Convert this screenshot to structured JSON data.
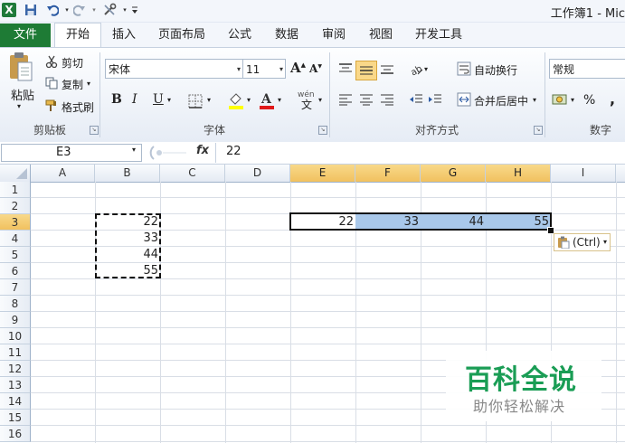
{
  "window": {
    "title": "工作簿1 - Mic",
    "app_logo": "X"
  },
  "quick_access": {
    "icons": [
      "save-icon",
      "undo-icon",
      "redo-icon",
      "tools-icon",
      "customize-icon"
    ]
  },
  "tabs": [
    {
      "label": "文件"
    },
    {
      "label": "开始"
    },
    {
      "label": "插入"
    },
    {
      "label": "页面布局"
    },
    {
      "label": "公式"
    },
    {
      "label": "数据"
    },
    {
      "label": "审阅"
    },
    {
      "label": "视图"
    },
    {
      "label": "开发工具"
    }
  ],
  "clipboard": {
    "paste": "粘贴",
    "cut": "剪切",
    "copy": "复制",
    "format_painter": "格式刷",
    "group": "剪贴板"
  },
  "font": {
    "name": "宋体",
    "size": "11",
    "grow": "A",
    "shrink": "A",
    "bold": "B",
    "italic": "I",
    "underline": "U",
    "group": "字体",
    "phonetic": "wén"
  },
  "alignment": {
    "wrap": "自动换行",
    "merge": "合并后居中",
    "group": "对齐方式"
  },
  "number": {
    "format": "常规",
    "percent": "%",
    "comma": ",",
    "group": "数字"
  },
  "formula_bar": {
    "name_box": "E3",
    "fx": "fx",
    "value": "22"
  },
  "columns": [
    "A",
    "B",
    "C",
    "D",
    "E",
    "F",
    "G",
    "H",
    "I"
  ],
  "rows": [
    "1",
    "2",
    "3",
    "4",
    "5",
    "6",
    "7",
    "8",
    "9",
    "10",
    "11",
    "12",
    "13",
    "14",
    "15",
    "16"
  ],
  "cells": {
    "B3": "22",
    "B4": "33",
    "B5": "44",
    "B6": "55",
    "E3": "22",
    "F3": "33",
    "G3": "44",
    "H3": "55"
  },
  "paste_options": {
    "label": "(Ctrl)"
  },
  "watermark": {
    "title": "百科全说",
    "subtitle": "助你轻松解决"
  }
}
